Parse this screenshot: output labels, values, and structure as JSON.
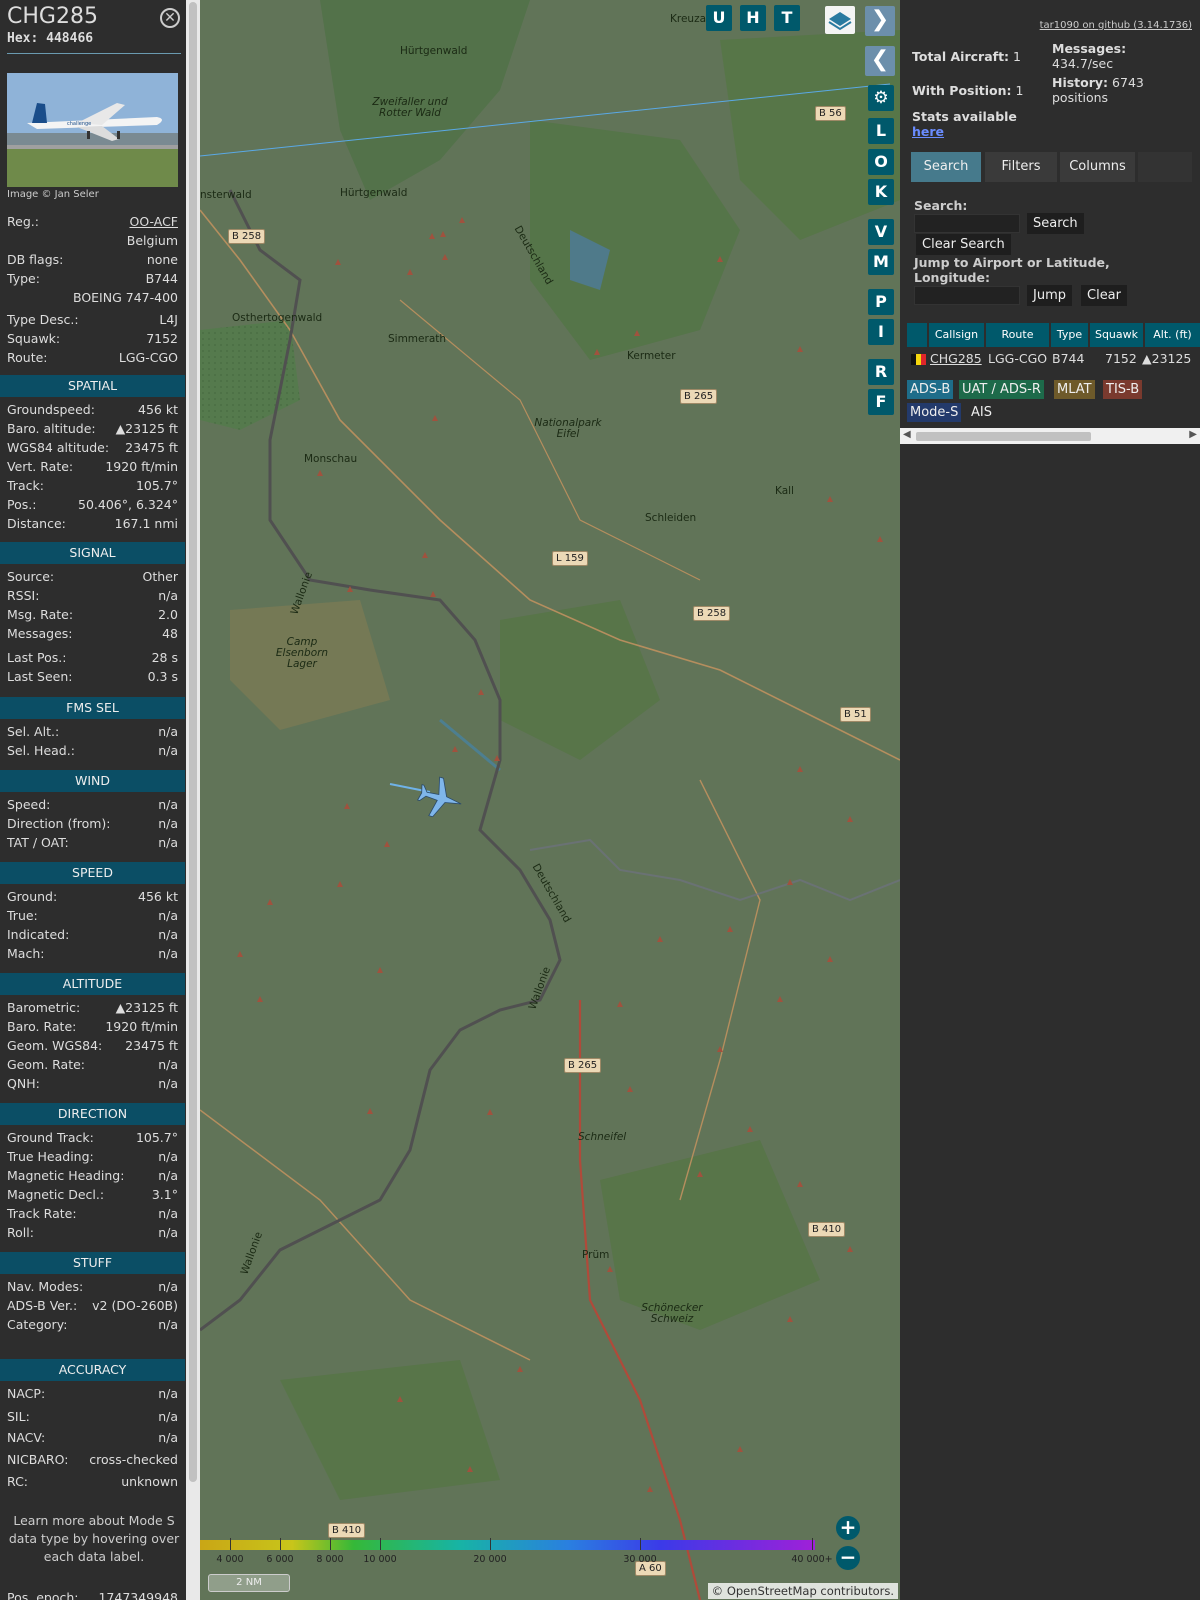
{
  "aircraft": {
    "callsign": "CHG285",
    "hex_label": "Hex:",
    "hex": "448466",
    "image_credit": "Image © Jan Seler",
    "details": [
      {
        "k": "Reg.:",
        "v": "OO-ACF"
      },
      {
        "k": "",
        "v": "Belgium"
      },
      {
        "k": "DB flags:",
        "v": "none"
      },
      {
        "k": "Type:",
        "v": "B744"
      },
      {
        "k": "",
        "v": "BOEING 747-400"
      },
      {
        "k": "Type Desc.:",
        "v": "L4J"
      },
      {
        "k": "Squawk:",
        "v": "7152"
      },
      {
        "k": "Route:",
        "v": "LGG-CGO"
      }
    ]
  },
  "sections": {
    "spatial": {
      "title": "SPATIAL",
      "rows": [
        {
          "k": "Groundspeed:",
          "v": "456 kt"
        },
        {
          "k": "Baro. altitude:",
          "v": "▲23125 ft"
        },
        {
          "k": "WGS84 altitude:",
          "v": "23475 ft"
        },
        {
          "k": "Vert. Rate:",
          "v": "1920 ft/min"
        },
        {
          "k": "Track:",
          "v": "105.7°"
        },
        {
          "k": "Pos.:",
          "v": "50.406°, 6.324°"
        },
        {
          "k": "Distance:",
          "v": "167.1 nmi"
        }
      ]
    },
    "signal": {
      "title": "SIGNAL",
      "rows": [
        {
          "k": "Source:",
          "v": "Other"
        },
        {
          "k": "RSSI:",
          "v": "n/a"
        },
        {
          "k": "Msg. Rate:",
          "v": "2.0"
        },
        {
          "k": "Messages:",
          "v": "48"
        },
        {
          "k": "Last Pos.:",
          "v": "28 s"
        },
        {
          "k": "Last Seen:",
          "v": "0.3 s"
        }
      ]
    },
    "fms": {
      "title": "FMS SEL",
      "rows": [
        {
          "k": "Sel. Alt.:",
          "v": "n/a"
        },
        {
          "k": "Sel. Head.:",
          "v": "n/a"
        }
      ]
    },
    "wind": {
      "title": "WIND",
      "rows": [
        {
          "k": "Speed:",
          "v": "n/a"
        },
        {
          "k": "Direction (from):",
          "v": "n/a"
        },
        {
          "k": "TAT / OAT:",
          "v": "n/a"
        }
      ]
    },
    "speed": {
      "title": "SPEED",
      "rows": [
        {
          "k": "Ground:",
          "v": "456 kt"
        },
        {
          "k": "True:",
          "v": "n/a"
        },
        {
          "k": "Indicated:",
          "v": "n/a"
        },
        {
          "k": "Mach:",
          "v": "n/a"
        }
      ]
    },
    "altitude": {
      "title": "ALTITUDE",
      "rows": [
        {
          "k": "Barometric:",
          "v": "▲23125 ft"
        },
        {
          "k": "Baro. Rate:",
          "v": "1920 ft/min"
        },
        {
          "k": "Geom. WGS84:",
          "v": "23475 ft"
        },
        {
          "k": "Geom. Rate:",
          "v": "n/a"
        },
        {
          "k": "QNH:",
          "v": "n/a"
        }
      ]
    },
    "direction": {
      "title": "DIRECTION",
      "rows": [
        {
          "k": "Ground Track:",
          "v": "105.7°"
        },
        {
          "k": "True Heading:",
          "v": "n/a"
        },
        {
          "k": "Magnetic Heading:",
          "v": "n/a"
        },
        {
          "k": "Magnetic Decl.:",
          "v": "3.1°"
        },
        {
          "k": "Track Rate:",
          "v": "n/a"
        },
        {
          "k": "Roll:",
          "v": "n/a"
        }
      ]
    },
    "stuff": {
      "title": "STUFF",
      "rows": [
        {
          "k": "Nav. Modes:",
          "v": "n/a"
        },
        {
          "k": "ADS-B Ver.:",
          "v": "v2 (DO-260B)"
        },
        {
          "k": "Category:",
          "v": "n/a"
        }
      ]
    },
    "accuracy": {
      "title": "ACCURACY",
      "rows": [
        {
          "k": "NACP:",
          "v": "n/a"
        },
        {
          "k": "SIL:",
          "v": "n/a"
        },
        {
          "k": "NACV:",
          "v": "n/a"
        },
        {
          "k": "NICBARO:",
          "v": "cross-checked"
        },
        {
          "k": "RC:",
          "v": "unknown"
        }
      ]
    }
  },
  "sidebar_note": "Learn more about Mode S data type by hovering over each data label.",
  "pos_epoch": {
    "k": "Pos. epoch:",
    "v": "1747349948"
  },
  "toolbar": {
    "top_buttons": [
      "U",
      "H",
      "T"
    ],
    "side_buttons": [
      "L",
      "O",
      "K",
      "V",
      "M",
      "P",
      "I",
      "R",
      "F"
    ]
  },
  "map": {
    "places": [
      {
        "t": "Kreuzau"
      },
      {
        "t": "Hürtgenwald"
      },
      {
        "t": "Zweifaller und Rotter Wald"
      },
      {
        "t": "Hürtgenwald"
      },
      {
        "t": "Simmerath"
      },
      {
        "t": "Osthertogenwald"
      },
      {
        "t": "Monschau"
      },
      {
        "t": "Kermeter"
      },
      {
        "t": "Nationalpark Eifel"
      },
      {
        "t": "Schleiden"
      },
      {
        "t": "Kall"
      },
      {
        "t": "Camp Elsenborn Lager"
      },
      {
        "t": "Schneifel"
      },
      {
        "t": "Prüm"
      },
      {
        "t": "Schönecker Schweiz"
      },
      {
        "t": "Deutschland"
      },
      {
        "t": "Wallonie"
      },
      {
        "t": "Deutschland"
      },
      {
        "t": "Wallonie"
      },
      {
        "t": "Wallonie"
      },
      {
        "t": "nsterwald"
      }
    ],
    "road_labels": [
      "B 56",
      "B 258",
      "B 265",
      "L 159",
      "B 258",
      "B 51",
      "B 265",
      "B 410",
      "B 410",
      "A 60"
    ],
    "altitude_ticks": [
      "4 000",
      "6 000",
      "8 000",
      "10 000",
      "20 000",
      "30 000",
      "40 000+"
    ],
    "scale": "2 NM",
    "attribution": "© OpenStreetMap contributors."
  },
  "stats": {
    "github": "tar1090 on github (3.14.1736)",
    "total_label": "Total Aircraft:",
    "total": "1",
    "with_pos_label": "With Position:",
    "with_pos": "1",
    "stats_label": "Stats available",
    "here": "here",
    "messages_label": "Messages:",
    "messages": "434.7/sec",
    "history_label": "History:",
    "history": "6743 positions"
  },
  "tabs": [
    "Search",
    "Filters",
    "Columns"
  ],
  "search": {
    "label": "Search:",
    "button": "Search",
    "clear": "Clear Search",
    "jump_label": "Jump to Airport or Latitude, Longitude:",
    "jump": "Jump",
    "clear2": "Clear"
  },
  "table": {
    "headers": [
      "Callsign",
      "Route",
      "Type",
      "Squawk",
      "Alt. (ft)"
    ],
    "rows": [
      {
        "callsign": "CHG285",
        "route": "LGG-CGO",
        "type": "B744",
        "squawk": "7152",
        "alt": "▲23125"
      }
    ]
  },
  "sources": [
    {
      "label": "ADS-B",
      "color": "#1e6d8a"
    },
    {
      "label": "UAT / ADS-R",
      "color": "#1d6a4a"
    },
    {
      "label": "MLAT",
      "color": "#6e5a2a"
    },
    {
      "label": "TIS-B",
      "color": "#7a3a2e"
    },
    {
      "label": "Mode-S",
      "color": "#233a6b"
    },
    {
      "label": "AIS",
      "color": "#2d2d2d"
    }
  ]
}
